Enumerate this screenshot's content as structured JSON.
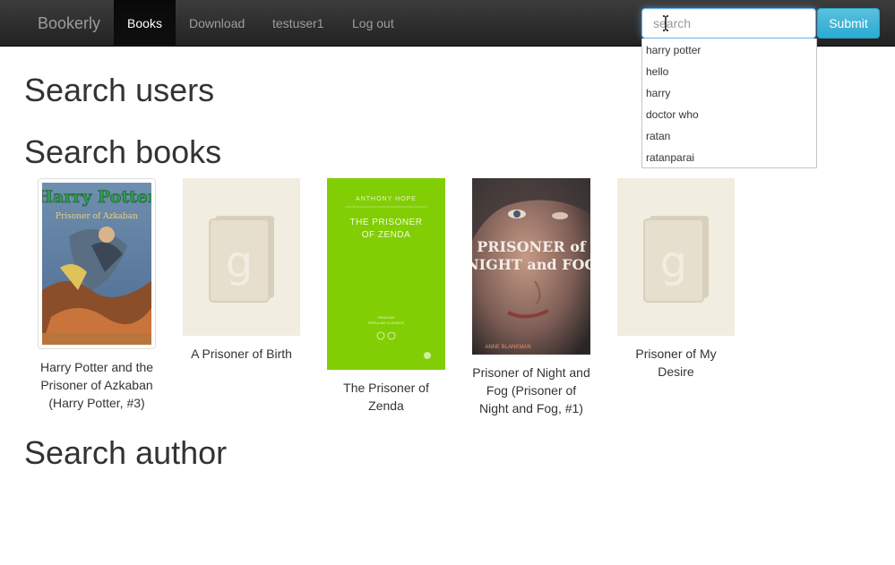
{
  "navbar": {
    "brand": "Bookerly",
    "links": [
      {
        "label": "Books",
        "active": true
      },
      {
        "label": "Download",
        "active": false
      },
      {
        "label": "testuser1",
        "active": false
      },
      {
        "label": "Log out",
        "active": false
      }
    ],
    "search": {
      "placeholder": "search",
      "value": ""
    },
    "submit_label": "Submit"
  },
  "autocomplete": [
    "harry potter",
    "hello",
    "harry",
    "doctor who",
    "ratan",
    "ratanparai"
  ],
  "sections": {
    "users": "Search users",
    "books": "Search books",
    "authors": "Search author"
  },
  "books": [
    {
      "title": "Harry Potter and the Prisoner of Azkaban (Harry Potter, #3)",
      "cover": "harry-potter-cover"
    },
    {
      "title": "A Prisoner of Birth",
      "cover": "placeholder-book-cover"
    },
    {
      "title": "The Prisoner of Zenda",
      "cover": "zenda-green-cover",
      "cover_text": {
        "author": "ANTHONY HOPE",
        "title": "THE PRISONER OF ZENDA",
        "series": "PENGUIN POPULAR CLASSICS"
      }
    },
    {
      "title": "Prisoner of Night and Fog (Prisoner of Night and Fog, #1)",
      "cover": "night-fog-cover",
      "cover_text": {
        "title_line1": "PRISONER of",
        "title_line2": "NIGHT and FOG",
        "author": "ANNE BLANKMAN"
      }
    },
    {
      "title": "Prisoner of My Desire",
      "cover": "placeholder-book-cover"
    }
  ],
  "colors": {
    "navbar_dark": "#222222",
    "submit_blue": "#5bc0de",
    "placeholder_bg": "#f1ede1",
    "placeholder_icon": "#d9d0bc",
    "zenda_green": "#7fcc00"
  }
}
